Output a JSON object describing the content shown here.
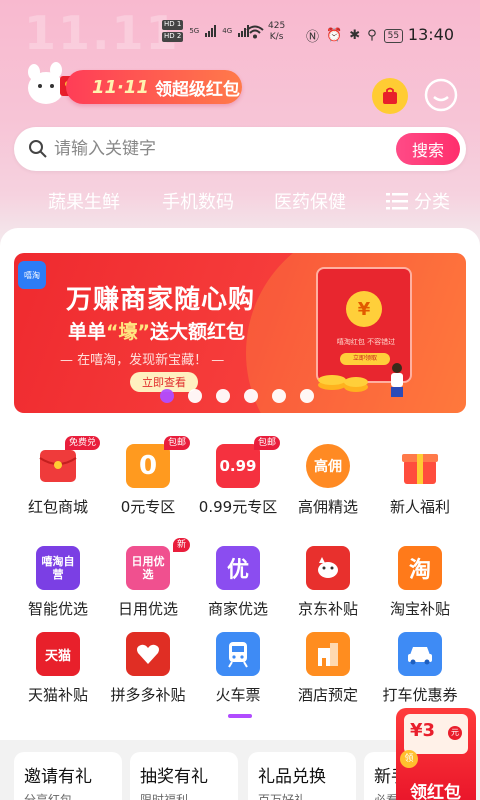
{
  "status": {
    "hd1": "HD 1",
    "hd2": "HD 2",
    "net1": "5G",
    "net2": "4G",
    "speed_val": "425",
    "speed_unit": "K/s",
    "battery": "55",
    "time": "13:40"
  },
  "header": {
    "watermark": "11.11",
    "promo_num": "11·11",
    "promo_text": "领超级红包"
  },
  "search": {
    "placeholder": "请输入关键字",
    "button": "搜索"
  },
  "categories": [
    "蔬果生鲜",
    "手机数码",
    "医药保健"
  ],
  "category_more": "分类",
  "banner": {
    "logo": "嘻淘",
    "title": "万赚商家随心购",
    "sub_pre": "单单",
    "sub_q": "“壕”",
    "sub_post": "送大额红包",
    "line": "— 在嘻淘，发现新宝藏！ —",
    "button": "立即查看",
    "env_coin": "¥",
    "env_text": "嘻淘红包 不容错过",
    "env_btn": "立即领取"
  },
  "grid": [
    {
      "label": "红包商城",
      "icon_text": "",
      "badge": "免费兑",
      "color": "#ef3b3b"
    },
    {
      "label": "0元专区",
      "icon_text": "0",
      "badge": "包邮",
      "color": "#ff9a1f"
    },
    {
      "label": "0.99元专区",
      "icon_text": "0.99",
      "badge": "包邮",
      "color": "#f5313f"
    },
    {
      "label": "高佣精选",
      "icon_text": "高佣",
      "badge": "",
      "color": "#ff8a23"
    },
    {
      "label": "新人福利",
      "icon_text": "",
      "badge": "",
      "color": "#ff4d3d"
    },
    {
      "label": "智能优选",
      "icon_text": "嘻淘自营",
      "badge": "",
      "color": "#7b3fe4"
    },
    {
      "label": "日用优选",
      "icon_text": "日用优选",
      "badge": "新",
      "color": "#f0508f"
    },
    {
      "label": "商家优选",
      "icon_text": "优",
      "badge": "",
      "color": "#8b4df0"
    },
    {
      "label": "京东补贴",
      "icon_text": "",
      "badge": "",
      "color": "#e8302d"
    },
    {
      "label": "淘宝补贴",
      "icon_text": "淘",
      "badge": "",
      "color": "#ff7a1a"
    },
    {
      "label": "天猫补贴",
      "icon_text": "天猫",
      "badge": "",
      "color": "#e8202b"
    },
    {
      "label": "拼多多补贴",
      "icon_text": "",
      "badge": "",
      "color": "#e02e24"
    },
    {
      "label": "火车票",
      "icon_text": "",
      "badge": "",
      "color": "#3e8bf5"
    },
    {
      "label": "酒店预定",
      "icon_text": "",
      "badge": "",
      "color": "#ff8d1f"
    },
    {
      "label": "打车优惠券",
      "icon_text": "",
      "badge": "",
      "color": "#3e8bf5"
    }
  ],
  "bottom_cards": [
    {
      "title": "邀请有礼",
      "sub": "分享红包"
    },
    {
      "title": "抽奖有礼",
      "sub": "限时福利"
    },
    {
      "title": "礼品兑换",
      "sub": "百万好礼"
    },
    {
      "title": "新手",
      "sub": "必看"
    }
  ],
  "floating": {
    "amount": "¥3",
    "yuan": "元",
    "coin": "领",
    "label": "领红包"
  }
}
